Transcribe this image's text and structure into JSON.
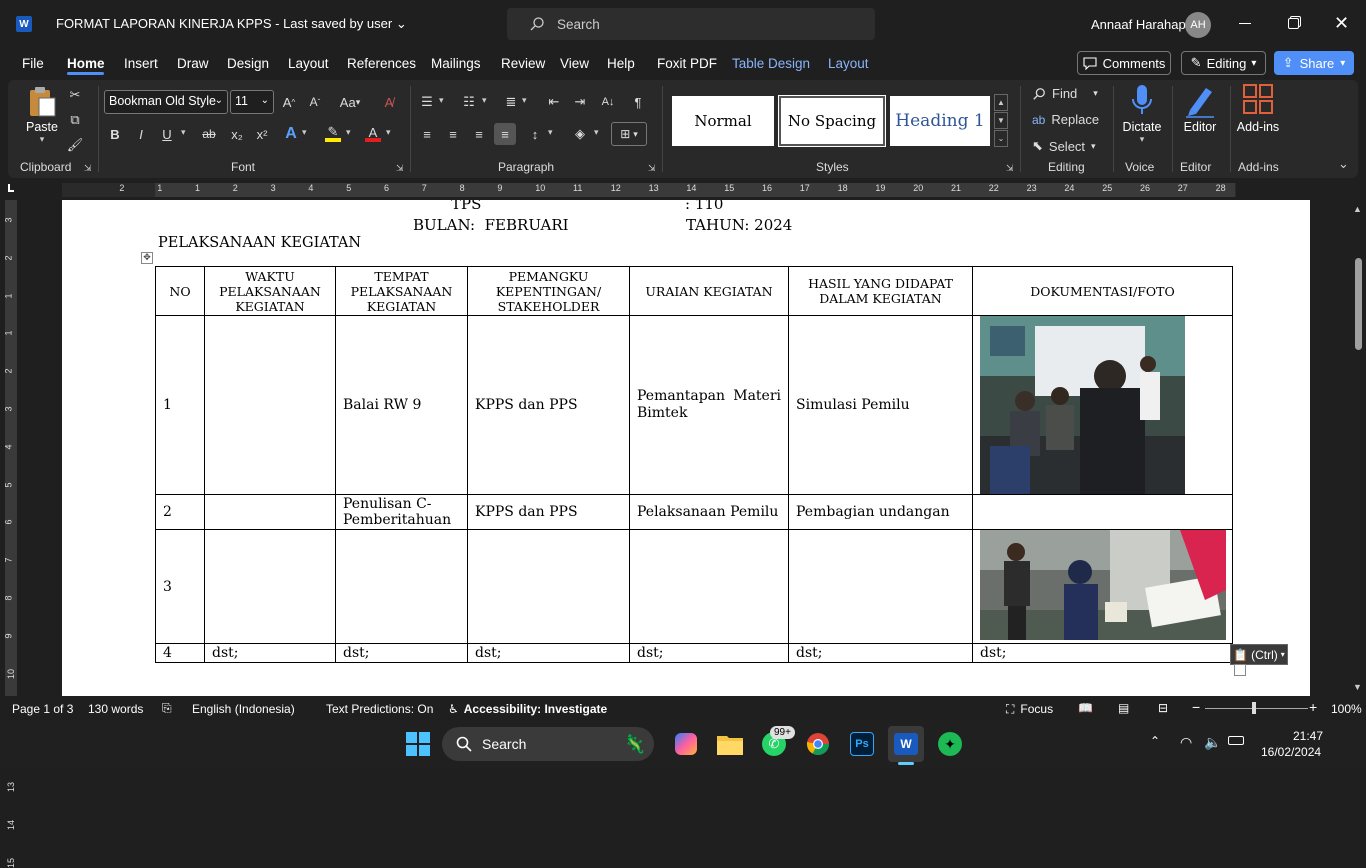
{
  "titlebar": {
    "app_icon": "W",
    "doc_title": "FORMAT LAPORAN KINERJA KPPS  -  Last saved by user",
    "search_placeholder": "Search",
    "user_name": "Annaaf Harahap",
    "avatar_initials": "AH"
  },
  "menu": {
    "tabs": [
      "File",
      "Home",
      "Insert",
      "Draw",
      "Design",
      "Layout",
      "References",
      "Mailings",
      "Review",
      "View",
      "Help",
      "Foxit PDF",
      "Table Design",
      "Layout"
    ],
    "comments": "Comments",
    "editing": "Editing",
    "share": "Share"
  },
  "ribbon": {
    "paste": "Paste",
    "font_name": "Bookman Old Style",
    "font_size": "11",
    "groups": {
      "clipboard": "Clipboard",
      "font": "Font",
      "paragraph": "Paragraph",
      "styles": "Styles",
      "editing": "Editing",
      "voice": "Voice",
      "editor": "Editor",
      "addins": "Add-ins"
    },
    "styles": [
      "Normal",
      "No Spacing",
      "Heading 1"
    ],
    "find": "Find",
    "replace": "Replace",
    "select": "Select",
    "dictate": "Dictate",
    "editor": "Editor",
    "addins": "Add-ins",
    "font_buttons": {
      "bold": "B",
      "italic": "I",
      "underline": "U",
      "strike": "ab",
      "sub": "x₂",
      "sup": "x²",
      "font_color": "A",
      "aa": "Aa"
    }
  },
  "ruler_numbers": [
    "2",
    "1",
    "1",
    "2",
    "3",
    "4",
    "5",
    "6",
    "7",
    "8",
    "9",
    "10",
    "11",
    "12",
    "13",
    "14",
    "15",
    "16",
    "17",
    "18",
    "19",
    "20",
    "21",
    "22",
    "23",
    "24",
    "25",
    "26",
    "27",
    "28"
  ],
  "vruler_numbers": [
    "3",
    "2",
    "1",
    "1",
    "2",
    "3",
    "4",
    "5",
    "6",
    "7",
    "8",
    "9",
    "10",
    "11",
    "12",
    "13",
    "14",
    "15"
  ],
  "document": {
    "tps_label": "TPS",
    "tps_value": ": 110",
    "bulan": "BULAN:  FEBRUARI",
    "tahun": "TAHUN: 2024",
    "section_title": "PELAKSANAAN KEGIATAN",
    "headers": [
      "NO",
      "WAKTU PELAKSANAAN KEGIATAN",
      "TEMPAT PELAKSANAAN KEGIATAN",
      "PEMANGKU KEPENTINGAN/ STAKEHOLDER",
      "URAIAN KEGIATAN",
      "HASIL YANG DIDAPAT DALAM KEGIATAN",
      "DOKUMENTASI/FOTO"
    ],
    "rows": [
      [
        "1",
        "",
        "Balai RW 9",
        "KPPS dan PPS",
        "Pemantapan Materi Bimtek",
        "Simulasi Pemilu",
        ""
      ],
      [
        "2",
        "",
        "Penulisan C-Pemberitahuan",
        "KPPS dan PPS",
        "Pelaksanaan Pemilu",
        "Pembagian undangan",
        ""
      ],
      [
        "3",
        "",
        "",
        "",
        "",
        "",
        ""
      ],
      [
        "4",
        "dst;",
        "dst;",
        "dst;",
        "dst;",
        "dst;",
        "dst;"
      ]
    ],
    "paste_options": "(Ctrl)"
  },
  "status": {
    "page": "Page 1 of 3",
    "words": "130 words",
    "language": "English (Indonesia)",
    "predictions": "Text Predictions: On",
    "accessibility": "Accessibility: Investigate",
    "focus": "Focus",
    "zoom": "100%"
  },
  "taskbar": {
    "search": "Search",
    "badge": "99+",
    "time": "21:47",
    "date": "16/02/2024"
  },
  "colors": {
    "accent": "#4f8ff7",
    "word_blue": "#185abd",
    "share": "#4f8ff7"
  }
}
